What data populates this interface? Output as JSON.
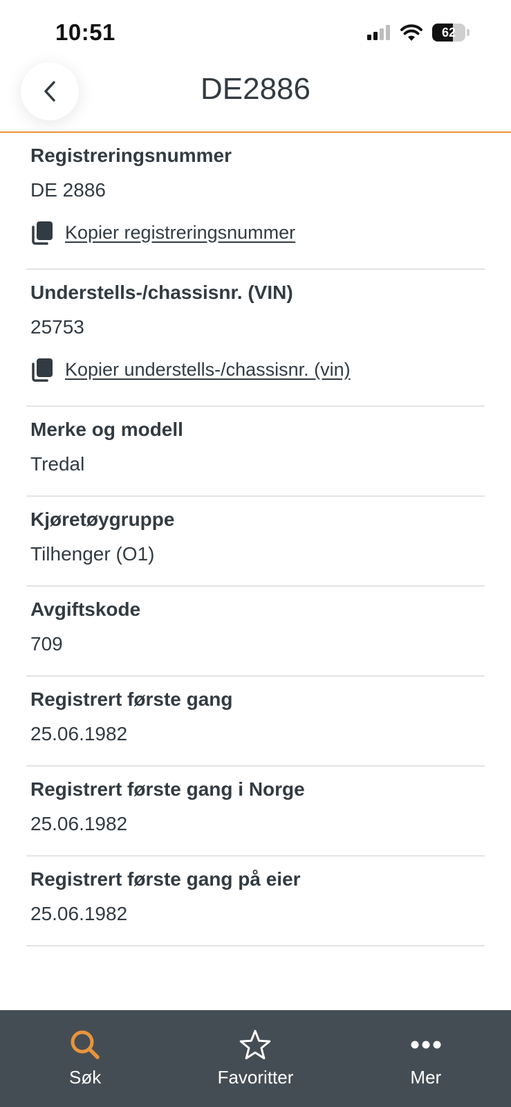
{
  "status_bar": {
    "time": "10:51",
    "battery": "62"
  },
  "header": {
    "title": "DE2886"
  },
  "fields": [
    {
      "label": "Registreringsnummer",
      "value": "DE 2886",
      "copy": "Kopier registreringsnummer"
    },
    {
      "label": "Understells-/chassisnr. (VIN)",
      "value": "25753",
      "copy": "Kopier understells-/chassisnr. (vin)"
    },
    {
      "label": "Merke og modell",
      "value": "Tredal"
    },
    {
      "label": "Kjøretøygruppe",
      "value": "Tilhenger (O1)"
    },
    {
      "label": "Avgiftskode",
      "value": "709"
    },
    {
      "label": "Registrert første gang",
      "value": "25.06.1982"
    },
    {
      "label": "Registrert første gang i Norge",
      "value": "25.06.1982"
    },
    {
      "label": "Registrert første gang på eier",
      "value": "25.06.1982"
    }
  ],
  "tabbar": {
    "items": [
      {
        "label": "Søk",
        "icon": "search-icon",
        "active": true
      },
      {
        "label": "Favoritter",
        "icon": "star-icon",
        "active": false
      },
      {
        "label": "Mer",
        "icon": "more-icon",
        "active": false
      }
    ]
  },
  "colors": {
    "accent": "#e8943a",
    "tabbar_bg": "#454d54",
    "text": "#333b42",
    "divider": "#e3e4e6"
  }
}
